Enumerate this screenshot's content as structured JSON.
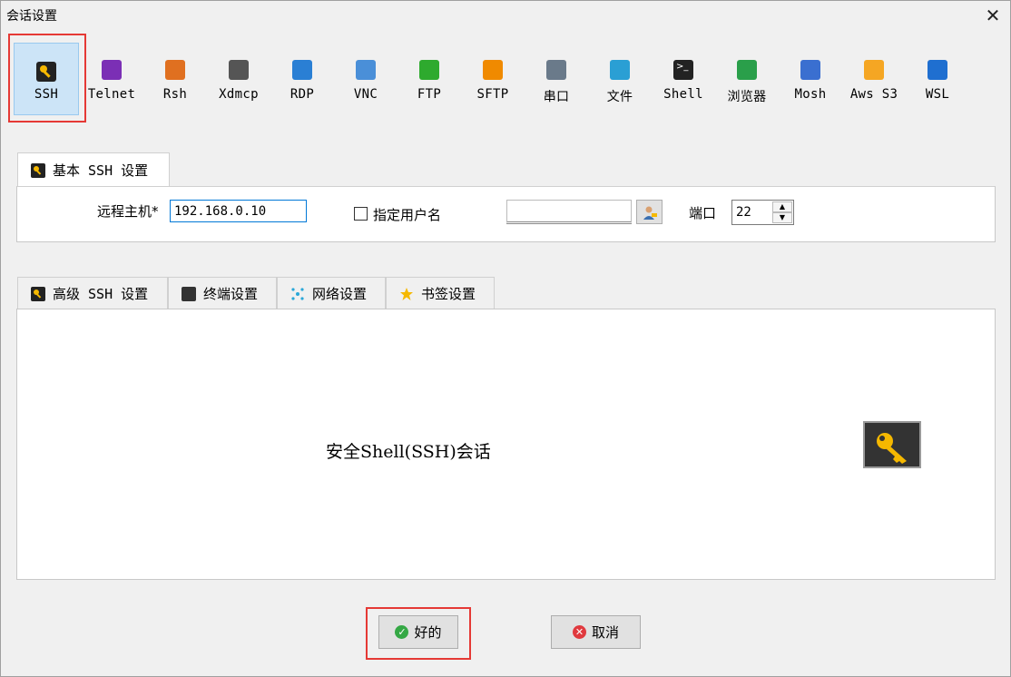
{
  "window": {
    "title": "会话设置"
  },
  "protocols": [
    {
      "label": "SSH",
      "icon": "key-icon",
      "color": "#f5b800"
    },
    {
      "label": "Telnet",
      "icon": "telnet-icon",
      "color": "#7b2fb5"
    },
    {
      "label": "Rsh",
      "icon": "rsh-icon",
      "color": "#e07020"
    },
    {
      "label": "Xdmcp",
      "icon": "xdmcp-icon",
      "color": "#555555"
    },
    {
      "label": "RDP",
      "icon": "rdp-icon",
      "color": "#2a7fd4"
    },
    {
      "label": "VNC",
      "icon": "vnc-icon",
      "color": "#4a8fd8"
    },
    {
      "label": "FTP",
      "icon": "ftp-icon",
      "color": "#2eaa2e"
    },
    {
      "label": "SFTP",
      "icon": "sftp-icon",
      "color": "#f08a00"
    },
    {
      "label": "串口",
      "icon": "serial-icon",
      "color": "#6a7a8a"
    },
    {
      "label": "文件",
      "icon": "file-icon",
      "color": "#2a9fd4"
    },
    {
      "label": "Shell",
      "icon": "shell-icon",
      "color": "#222222"
    },
    {
      "label": "浏览器",
      "icon": "browser-icon",
      "color": "#2a9f4a"
    },
    {
      "label": "Mosh",
      "icon": "mosh-icon",
      "color": "#3a6fd0"
    },
    {
      "label": "Aws S3",
      "icon": "aws-icon",
      "color": "#f5a623"
    },
    {
      "label": "WSL",
      "icon": "wsl-icon",
      "color": "#1f6fd0"
    }
  ],
  "basic": {
    "tab_label": "基本 SSH 设置",
    "host_label": "远程主机*",
    "host_value": "192.168.0.10",
    "username_label": "指定用户名",
    "username_value": "",
    "port_label": "端口",
    "port_value": "22"
  },
  "tabs": [
    {
      "label": "高级 SSH 设置",
      "icon": "key-icon"
    },
    {
      "label": "终端设置",
      "icon": "terminal-icon"
    },
    {
      "label": "网络设置",
      "icon": "network-icon"
    },
    {
      "label": "书签设置",
      "icon": "star-icon"
    }
  ],
  "description": "安全Shell(SSH)会话",
  "buttons": {
    "ok": "好的",
    "cancel": "取消"
  }
}
